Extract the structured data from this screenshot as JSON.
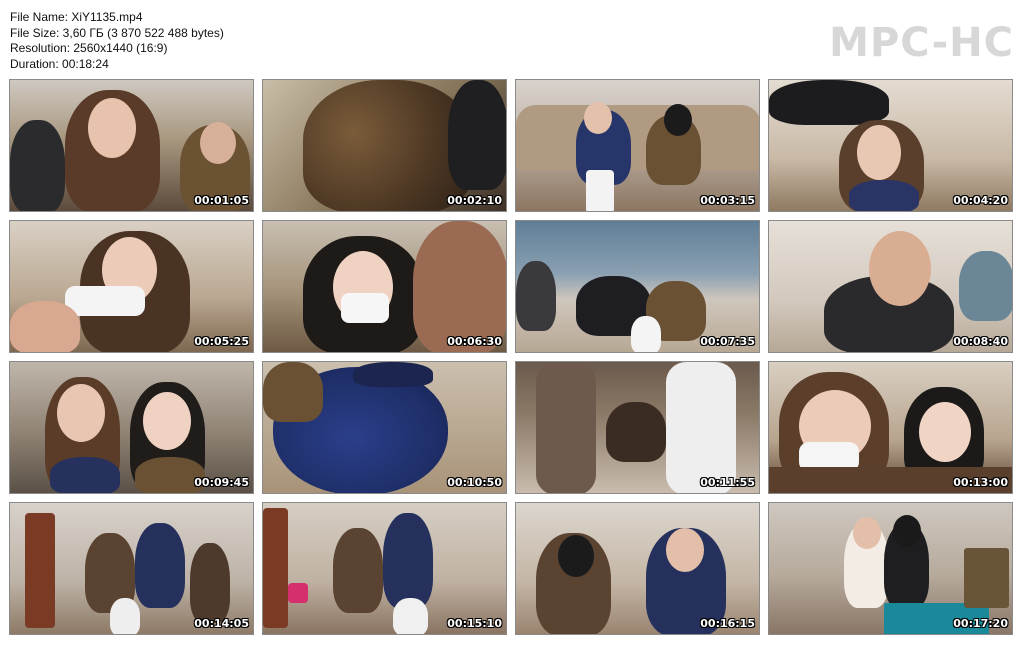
{
  "info": {
    "file_name": "File Name: XiY1135.mp4",
    "file_size": "File Size: 3,60 ГБ (3 870 522 488 bytes)",
    "resolution": "Resolution: 2560x1440 (16:9)",
    "duration": "Duration: 00:18:24"
  },
  "logo": "MPC-HC",
  "thumbnails": [
    {
      "time": "00:01:05"
    },
    {
      "time": "00:02:10"
    },
    {
      "time": "00:03:15"
    },
    {
      "time": "00:04:20"
    },
    {
      "time": "00:05:25"
    },
    {
      "time": "00:06:30"
    },
    {
      "time": "00:07:35"
    },
    {
      "time": "00:08:40"
    },
    {
      "time": "00:09:45"
    },
    {
      "time": "00:10:50"
    },
    {
      "time": "00:11:55"
    },
    {
      "time": "00:13:00"
    },
    {
      "time": "00:14:05"
    },
    {
      "time": "00:15:10"
    },
    {
      "time": "00:16:15"
    },
    {
      "time": "00:17:20"
    }
  ]
}
